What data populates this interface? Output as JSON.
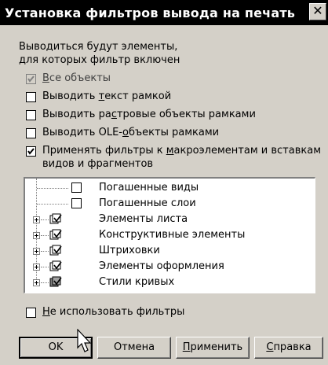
{
  "window": {
    "title": "Установка фильтров вывода на печать",
    "close_glyph": "✕"
  },
  "intro": {
    "line1": "Выводиться будут элементы,",
    "line2": "для которых фильтр включен"
  },
  "options": [
    {
      "pre": "",
      "mn": "В",
      "post": "се объекты",
      "checked": true,
      "disabled": true
    },
    {
      "pre": "Выводить ",
      "mn": "т",
      "post": "екст рамкой",
      "checked": false,
      "disabled": false
    },
    {
      "pre": "Выводить ра",
      "mn": "с",
      "post": "тровые объекты рамками",
      "checked": false,
      "disabled": false
    },
    {
      "pre": "Выводить OLE-",
      "mn": "о",
      "post": "бъекты рамками",
      "checked": false,
      "disabled": false
    },
    {
      "pre": "Применять фильтры  к ",
      "mn": "м",
      "post": "акроэлементам и вставкам",
      "line2": "видов и фрагментов",
      "checked": true,
      "disabled": false
    }
  ],
  "tree": {
    "items": [
      {
        "label": "Погашенные виды",
        "expandable": false,
        "state": "unchecked"
      },
      {
        "label": "Погашенные слои",
        "expandable": false,
        "state": "unchecked"
      },
      {
        "label": "Элементы листа",
        "expandable": true,
        "state": "checked"
      },
      {
        "label": "Конструктивные элементы",
        "expandable": true,
        "state": "checked"
      },
      {
        "label": "Штриховки",
        "expandable": true,
        "state": "checked"
      },
      {
        "label": "Элементы оформления",
        "expandable": true,
        "state": "checked"
      },
      {
        "label": "Стили кривых",
        "expandable": true,
        "state": "partial"
      }
    ]
  },
  "no_filters": {
    "pre": "",
    "mn": "Н",
    "post": "е использовать фильтры",
    "checked": false
  },
  "buttons": {
    "ok": "OK",
    "cancel": "Отмена",
    "apply_mn": "П",
    "apply_rest": "рименить",
    "help_mn": "С",
    "help_rest": "правка"
  }
}
